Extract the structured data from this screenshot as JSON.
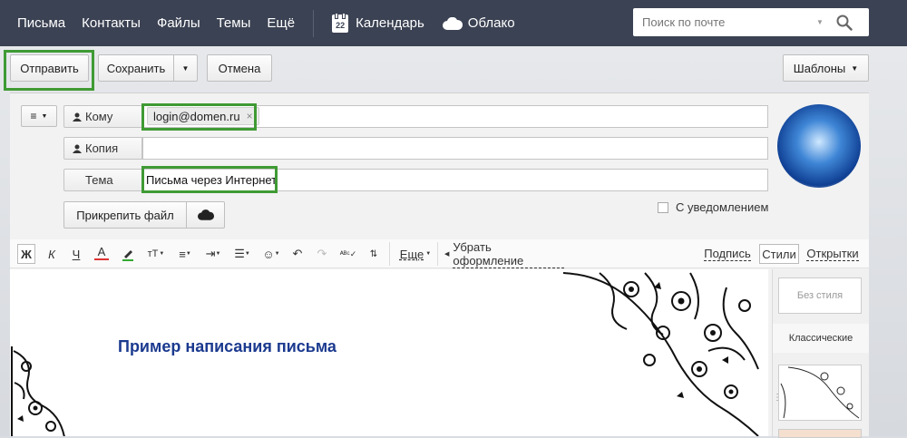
{
  "nav": {
    "items": [
      "Письма",
      "Контакты",
      "Файлы",
      "Темы",
      "Ещё"
    ],
    "calendar_label": "Календарь",
    "calendar_day": "22",
    "cloud_label": "Облако"
  },
  "search": {
    "placeholder": "Поиск по почте"
  },
  "actions": {
    "send": "Отправить",
    "save": "Сохранить",
    "cancel": "Отмена",
    "templates": "Шаблоны"
  },
  "compose": {
    "to_label": "Кому",
    "to_recipient": "login@domen.ru",
    "cc_label": "Копия",
    "subject_label": "Тема",
    "subject_value": "Письма через Интернет",
    "attach": "Прикрепить файл",
    "notify": "С уведомлением"
  },
  "toolbar": {
    "bold": "Ж",
    "italic": "К",
    "underline": "Ч",
    "color": "А",
    "font_size": "тТ",
    "more": "Еще",
    "clear_format": "Убрать оформление",
    "signature": "Подпись",
    "styles": "Стили",
    "cards": "Открытки"
  },
  "editor": {
    "heading": "Пример написания письма"
  },
  "styles_panel": {
    "no_style": "Без стиля",
    "classic": "Классические"
  },
  "colors": {
    "topbar": "#3b4253",
    "highlight": "#3f9a34",
    "heading": "#1b3a8f"
  }
}
